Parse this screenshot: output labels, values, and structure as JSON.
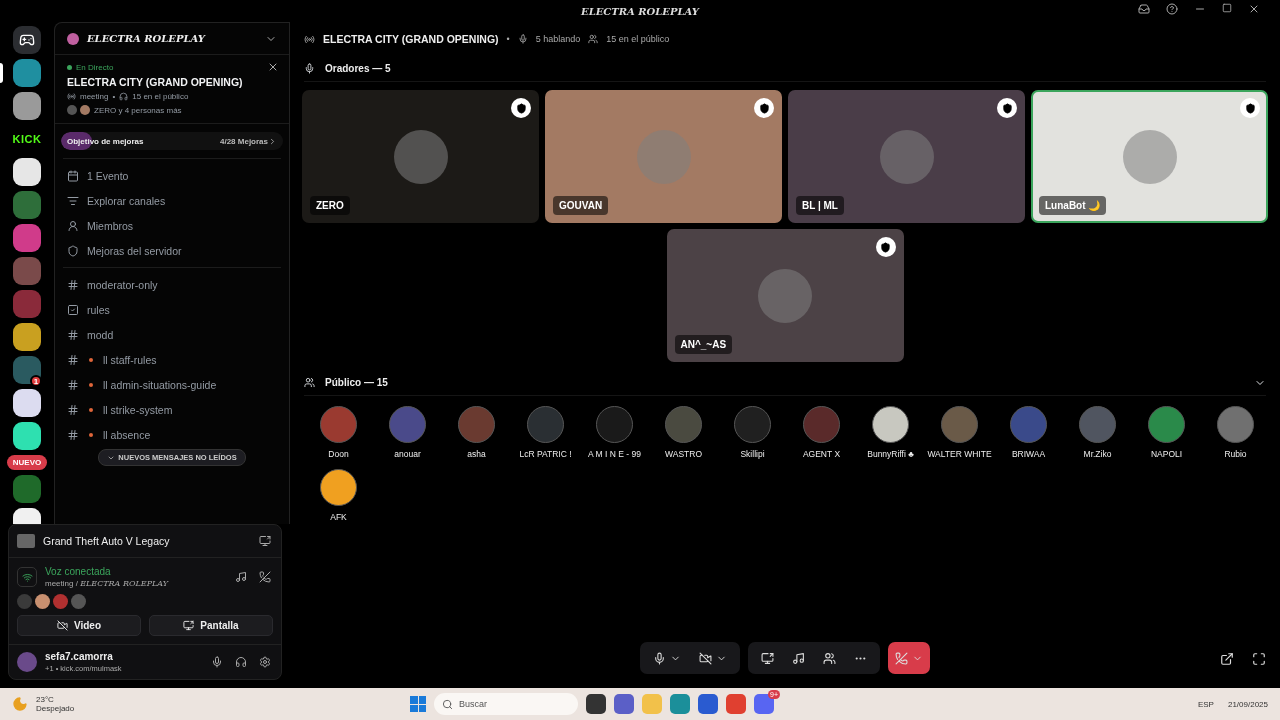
{
  "window": {
    "title": "ELECTRA ROLEPLAY"
  },
  "servers": [
    {
      "kind": "home",
      "selected": false
    },
    {
      "kind": "image",
      "color": "#1f8fa0",
      "selected": true
    },
    {
      "kind": "image",
      "color": "#9a9a9a",
      "selected": false
    },
    {
      "kind": "text",
      "label": "KICK",
      "selected": false
    },
    {
      "kind": "image",
      "color": "#e6e6e6",
      "selected": false
    },
    {
      "kind": "image",
      "color": "#2e6e3a",
      "selected": false
    },
    {
      "kind": "image",
      "color": "#d03b8a",
      "selected": false
    },
    {
      "kind": "image",
      "color": "#7a4a4a",
      "selected": false
    },
    {
      "kind": "image",
      "color": "#8a2a3a",
      "selected": false
    },
    {
      "kind": "image",
      "color": "#c9a020",
      "selected": false
    },
    {
      "kind": "image",
      "color": "#2a5a60",
      "selected": false,
      "badge": "1"
    },
    {
      "kind": "image",
      "color": "#dcdcf0",
      "selected": false
    },
    {
      "kind": "image",
      "color": "#2ee0b0",
      "selected": false
    },
    {
      "kind": "image",
      "color": "#1f6a2a",
      "selected": false,
      "badge_new": "NUEVO"
    },
    {
      "kind": "image",
      "color": "#f0f0f0",
      "selected": false
    }
  ],
  "server": {
    "name": "ELECTRA ROLEPLAY"
  },
  "live": {
    "status": "En Directo",
    "title": "ELECTRA CITY (GRAND OPENING)",
    "channel": "meeting",
    "separator": "•",
    "audience": "15 en el público",
    "people": "ZERO y 4 personas más"
  },
  "boost": {
    "label": "Objetivo de mejoras",
    "count": "4/28 Mejoras",
    "level": 0.14
  },
  "menu": [
    {
      "kind": "event",
      "label": "1 Evento"
    },
    {
      "kind": "browse",
      "label": "Explorar canales"
    },
    {
      "kind": "members",
      "label": "Miembros"
    },
    {
      "kind": "boost",
      "label": "Mejoras del servidor"
    }
  ],
  "channels": [
    {
      "kind": "locked",
      "label": "moderator-only",
      "dot": false
    },
    {
      "kind": "rules",
      "label": "rules",
      "dot": false
    },
    {
      "kind": "locked",
      "label": "modd",
      "dot": false
    },
    {
      "kind": "locked",
      "label": "ll staff-rules",
      "dot": true
    },
    {
      "kind": "locked",
      "label": "ll admin-situations-guide",
      "dot": true
    },
    {
      "kind": "locked",
      "label": "ll strike-system",
      "dot": true
    },
    {
      "kind": "locked",
      "label": "ll absence",
      "dot": true
    }
  ],
  "unread_pill": "NUEVOS MENSAJES NO LEÍDOS",
  "activity": {
    "game": "Grand Theft Auto V Legacy"
  },
  "voice": {
    "status": "Voz conectada",
    "location": "meeting / ",
    "server": "ELECTRA ROLEPLAY",
    "participants": [
      {
        "color": "#3a3a3a"
      },
      {
        "color": "#c89070"
      },
      {
        "color": "#b03030"
      },
      {
        "color": "#555555"
      }
    ]
  },
  "voice_buttons": [
    {
      "kind": "video",
      "label": "Video"
    },
    {
      "kind": "screen",
      "label": "Pantalla"
    }
  ],
  "user": {
    "name": "sefa7.camorra",
    "status": "+1 • kick.com/mulmask"
  },
  "stage": {
    "title": "ELECTRA CITY (GRAND OPENING)",
    "separator": "•",
    "speaking": "5 hablando",
    "audience": "15 en el público"
  },
  "speakers_heading": "Oradores — 5",
  "speakers": [
    {
      "name": "ZERO",
      "color": "#1c1a17",
      "speaking": false
    },
    {
      "name": "GOUVAN",
      "color": "#a37a63",
      "speaking": false
    },
    {
      "name": "BL | ML",
      "color": "#4a3d48",
      "speaking": false
    },
    {
      "name": "LunaBot 🌙",
      "color": "#e2e2de",
      "speaking": true
    },
    {
      "name": "AN^_~AS",
      "color": "#4c4246",
      "speaking": false
    }
  ],
  "audience_heading": "Público — 15",
  "audience": [
    {
      "name": "Doon",
      "color": "#9a3a30"
    },
    {
      "name": "anouar",
      "color": "#4a4a8a"
    },
    {
      "name": "asha",
      "color": "#6a3a30"
    },
    {
      "name": "LcR PATRIC !",
      "color": "#2a2f33"
    },
    {
      "name": "A M I N E - 99",
      "color": "#1a1a1a"
    },
    {
      "name": "WASTRO",
      "color": "#4a4a40"
    },
    {
      "name": "Skillipi",
      "color": "#202020"
    },
    {
      "name": "AGENT X",
      "color": "#5a2a2a"
    },
    {
      "name": "BunnyRiffi ♣",
      "color": "#c8c8c0"
    },
    {
      "name": "WALTER WHITE",
      "color": "#6a5a48"
    },
    {
      "name": "BRIWAA",
      "color": "#3a4a8a"
    },
    {
      "name": "Mr.Ziko",
      "color": "#505560"
    },
    {
      "name": "NAPOLI",
      "color": "#2a8a4a"
    },
    {
      "name": "Rubio",
      "color": "#707070"
    },
    {
      "name": "AFK",
      "color": "#f0a020"
    }
  ],
  "controls": [
    {
      "kind": "mic"
    },
    {
      "kind": "camera"
    },
    {
      "kind": "share"
    },
    {
      "kind": "sound"
    },
    {
      "kind": "activity"
    },
    {
      "kind": "more"
    },
    {
      "kind": "hangup"
    }
  ],
  "taskbar": {
    "temp": "23°C",
    "weather": "Despejado",
    "search": "Buscar",
    "apps": [
      {
        "kind": "files"
      },
      {
        "kind": "teams"
      },
      {
        "kind": "folder"
      },
      {
        "kind": "edge"
      },
      {
        "kind": "store"
      },
      {
        "kind": "chrome"
      },
      {
        "kind": "discord",
        "badge": "9+"
      }
    ],
    "lang": "ESP",
    "date": "21/09/2025"
  }
}
